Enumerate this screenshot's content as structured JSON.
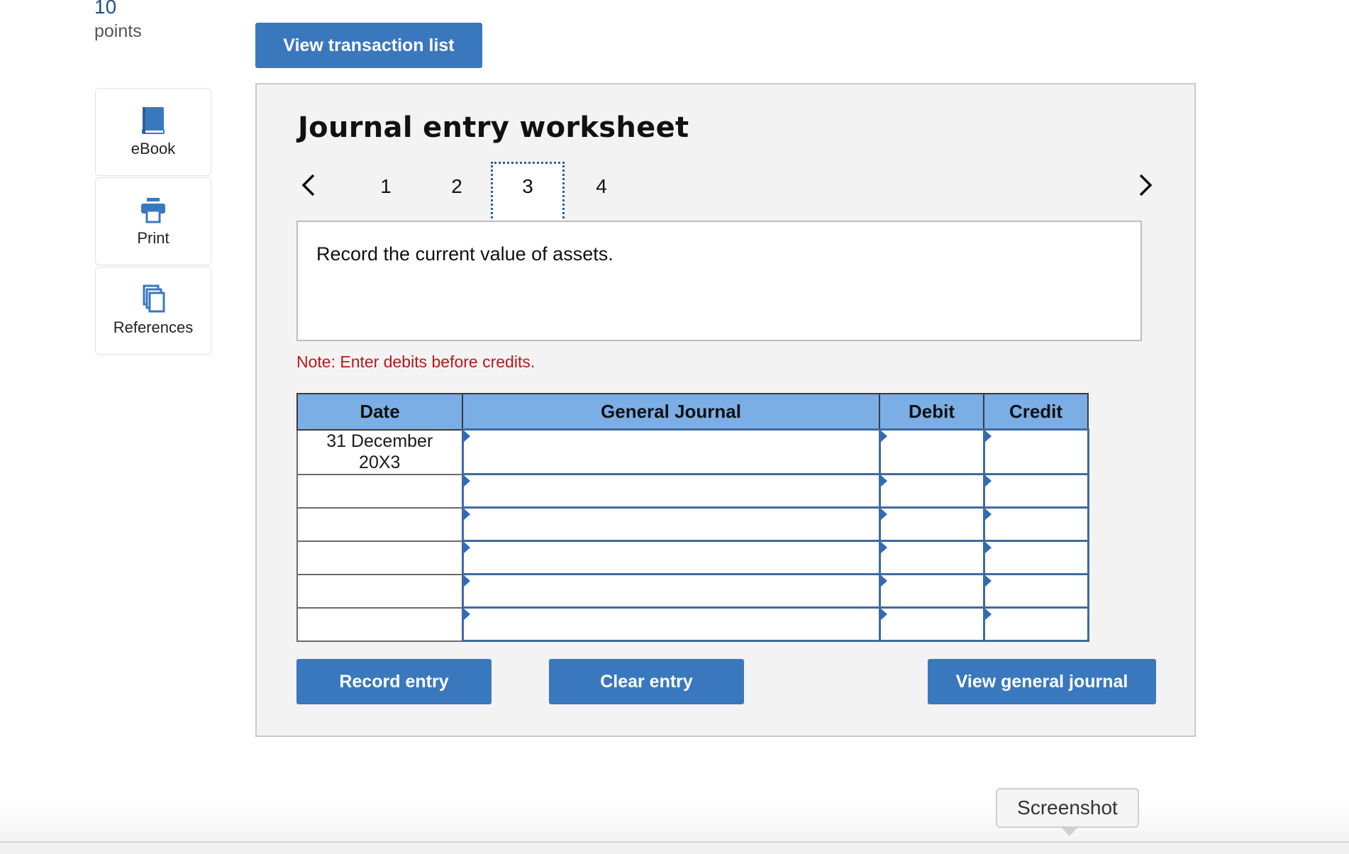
{
  "points": {
    "value": "10",
    "label": "points"
  },
  "sidebar": {
    "items": [
      {
        "label": "eBook",
        "icon": "book-icon"
      },
      {
        "label": "Print",
        "icon": "printer-icon"
      },
      {
        "label": "References",
        "icon": "copy-icon"
      }
    ]
  },
  "top_button": "View transaction list",
  "worksheet": {
    "title": "Journal entry worksheet",
    "steps": [
      "1",
      "2",
      "3",
      "4"
    ],
    "active_step": "3",
    "instruction": "Record the current value of assets.",
    "note": "Note: Enter debits before credits."
  },
  "table": {
    "headers": {
      "date": "Date",
      "journal": "General Journal",
      "debit": "Debit",
      "credit": "Credit"
    },
    "rows": [
      {
        "date_line1": "31 December",
        "date_line2": "20X3",
        "account": "",
        "debit": "",
        "credit": ""
      },
      {
        "date_line1": "",
        "date_line2": "",
        "account": "",
        "debit": "",
        "credit": ""
      },
      {
        "date_line1": "",
        "date_line2": "",
        "account": "",
        "debit": "",
        "credit": ""
      },
      {
        "date_line1": "",
        "date_line2": "",
        "account": "",
        "debit": "",
        "credit": ""
      },
      {
        "date_line1": "",
        "date_line2": "",
        "account": "",
        "debit": "",
        "credit": ""
      },
      {
        "date_line1": "",
        "date_line2": "",
        "account": "",
        "debit": "",
        "credit": ""
      }
    ]
  },
  "buttons": {
    "record": "Record entry",
    "clear": "Clear entry",
    "view_journal": "View general journal"
  },
  "tooltip": "Screenshot",
  "colors": {
    "accent": "#3a78be",
    "header": "#7aaee5",
    "note": "#b8191a"
  }
}
